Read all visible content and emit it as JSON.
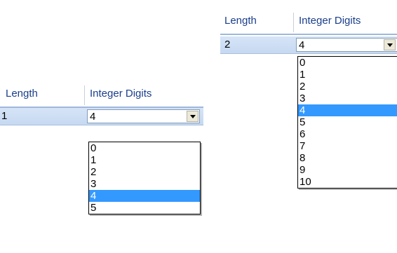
{
  "left_grid": {
    "headers": {
      "length": "Length",
      "integer_digits": "Integer Digits"
    },
    "row": {
      "length": "1",
      "integer_digits": "4"
    },
    "dropdown_options": [
      "0",
      "1",
      "2",
      "3",
      "4",
      "5"
    ],
    "selected_option": "4"
  },
  "right_grid": {
    "headers": {
      "length": "Length",
      "integer_digits": "Integer Digits"
    },
    "row": {
      "length": "2",
      "integer_digits": "4"
    },
    "dropdown_options": [
      "0",
      "1",
      "2",
      "3",
      "4",
      "5",
      "6",
      "7",
      "8",
      "9",
      "10"
    ],
    "selected_option": "4"
  },
  "colors": {
    "selection": "#3399ff",
    "header_text": "#1a3e8c",
    "row_bg": "#d6e4f7"
  }
}
